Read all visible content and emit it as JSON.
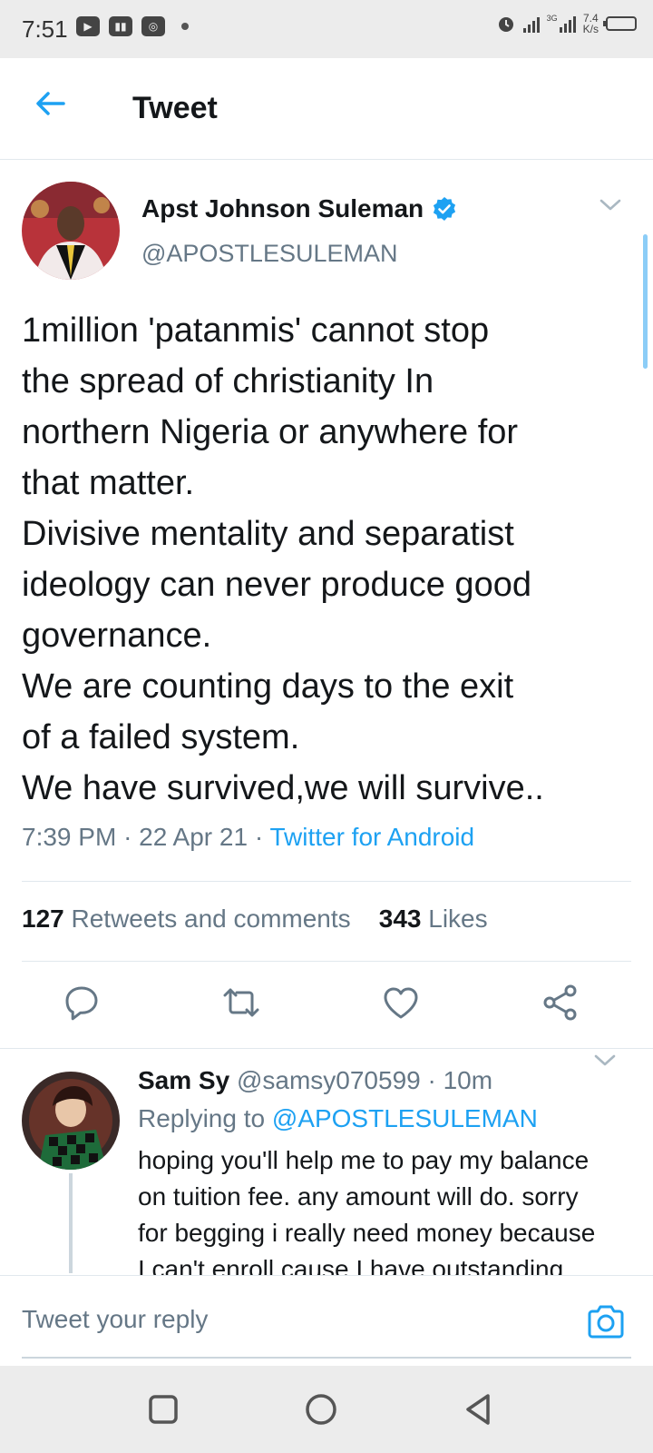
{
  "status_bar": {
    "time": "7:51",
    "net_speed_value": "7.4",
    "net_speed_unit": "K/s",
    "network_label": "3G"
  },
  "header": {
    "title": "Tweet"
  },
  "tweet": {
    "author_name": "Apst Johnson Suleman",
    "author_handle": "@APOSTLESULEMAN",
    "text_lines": [
      "1million 'patanmis' cannot stop",
      "the spread of christianity In",
      "northern Nigeria or anywhere for",
      "that matter.",
      "Divisive mentality and separatist",
      "ideology can never produce good",
      "governance.",
      "We are counting days to the exit",
      "of a failed system.",
      "We have survived,we will survive.."
    ],
    "time": "7:39 PM",
    "date": "22 Apr 21",
    "source": "Twitter for Android",
    "retweets_count": "127",
    "retweets_label": "Retweets and comments",
    "likes_count": "343",
    "likes_label": "Likes"
  },
  "reply": {
    "name": "Sam Sy",
    "handle": "@samsy070599",
    "time": "10m",
    "replying_to_label": "Replying to",
    "replying_to_handle": "@APOSTLESULEMAN",
    "text_lines": [
      "hoping you'll help me to pay my balance",
      "on tuition fee. any amount will do. sorry",
      "for begging i really need money because",
      "I can't enroll cause I have outstanding"
    ]
  },
  "compose": {
    "placeholder": "Tweet your reply"
  },
  "colors": {
    "accent": "#1da1f2",
    "secondary_text": "#657786",
    "primary_text": "#14171a",
    "divider": "#e1e8ed"
  }
}
